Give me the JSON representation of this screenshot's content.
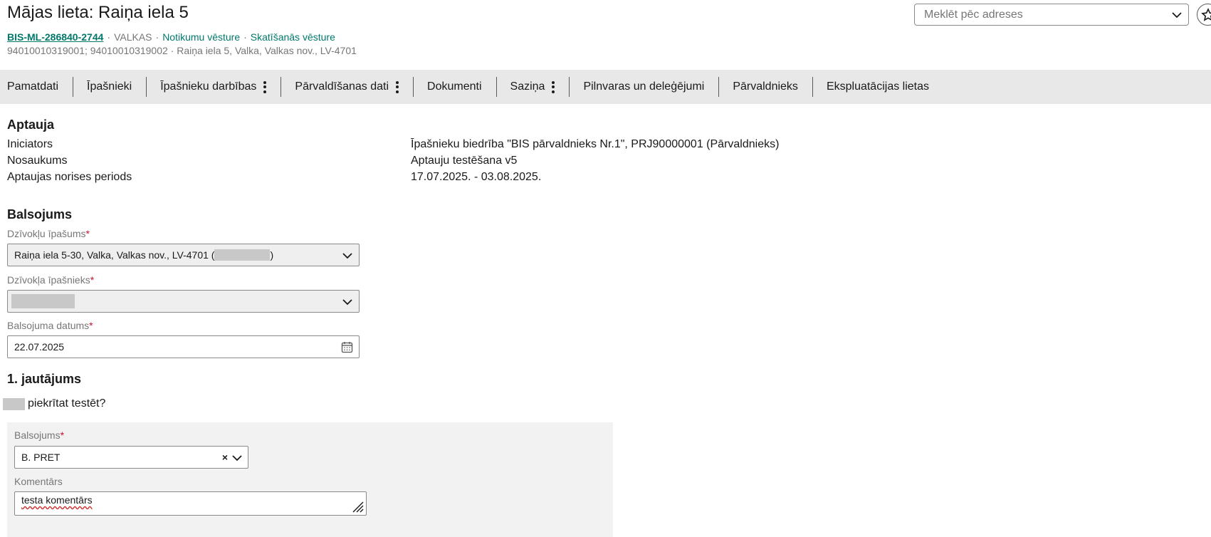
{
  "header": {
    "title": "Mājas lieta: Raiņa iela 5",
    "case_id": "BIS-ML-286840-2744",
    "region": "VALKAS",
    "events_history_link": "Notikumu vēsture",
    "view_history_link": "Skatīšanās vēsture",
    "sub_info": "94010010319001; 94010010319002 · Raiņa iela 5, Valka, Valkas nov., LV-4701"
  },
  "search": {
    "placeholder": "Meklēt pēc adreses",
    "icon": "chevron-down-icon"
  },
  "star_icon": "star-icon",
  "tabs": [
    {
      "label": "Pamatdati",
      "has_menu": false
    },
    {
      "label": "Īpašnieki",
      "has_menu": false
    },
    {
      "label": "Īpašnieku darbības",
      "has_menu": true
    },
    {
      "label": "Pārvaldīšanas dati",
      "has_menu": true
    },
    {
      "label": "Dokumenti",
      "has_menu": false
    },
    {
      "label": "Saziņa",
      "has_menu": true
    },
    {
      "label": "Pilnvaras un deleģējumi",
      "has_menu": false
    },
    {
      "label": "Pārvaldnieks",
      "has_menu": false
    },
    {
      "label": "Ekspluatācijas lietas",
      "has_menu": false
    }
  ],
  "survey": {
    "heading": "Aptauja",
    "rows": [
      {
        "label": "Iniciators",
        "value": "Īpašnieku biedrība \"BIS pārvaldnieks Nr.1\", PRJ90000001 (Pārvaldnieks)"
      },
      {
        "label": "Nosaukums",
        "value": "Aptauju testēšana v5"
      },
      {
        "label": "Aptaujas norises periods",
        "value": "17.07.2025. - 03.08.2025."
      }
    ]
  },
  "vote": {
    "heading": "Balsojums",
    "property_label": "Dzīvokļu īpašums",
    "property_value": "Raiņa iela 5-30, Valka, Valkas nov., LV-4701 (",
    "property_value_end": ")",
    "owner_label": "Dzīvokļa īpašnieks",
    "date_label": "Balsojuma datums",
    "date_value": "22.07.2025",
    "required_mark": "*"
  },
  "question": {
    "heading": "1. jautājums",
    "text": "piekrītat testēt?",
    "vote_label": "Balsojums",
    "vote_value": "B. PRET",
    "clear_symbol": "×",
    "comment_label": "Komentārs",
    "comment_value": "testa komentārs"
  },
  "colors": {
    "link": "#00796b",
    "required": "#c8102e",
    "tab_bar": "#e8e8e8",
    "panel": "#f2f2f2"
  }
}
